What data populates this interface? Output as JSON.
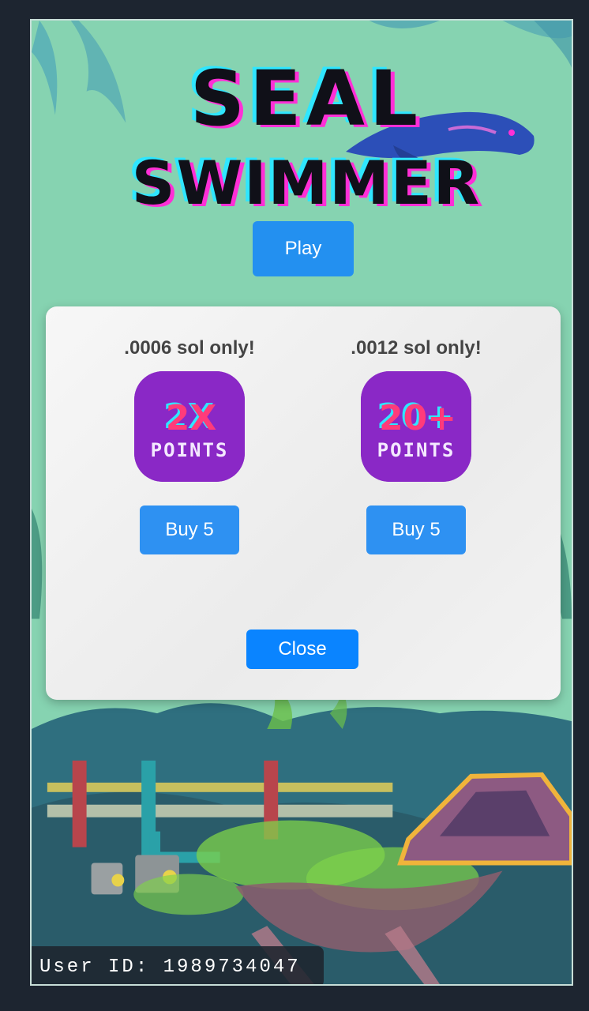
{
  "game": {
    "title_line1": "SEAL",
    "title_line2": "SWIMMER",
    "play_label": "Play"
  },
  "shop": {
    "offers": [
      {
        "price": ".0006 sol only!",
        "badge_top": "2X",
        "badge_bottom": "POINTS",
        "buy_label": "Buy 5"
      },
      {
        "price": ".0012 sol only!",
        "badge_top": "20+",
        "badge_bottom": "POINTS",
        "buy_label": "Buy 5"
      }
    ],
    "close_label": "Close"
  },
  "footer": {
    "user_id": "User ID: 1989734047"
  },
  "colors": {
    "background": "#86d3b1",
    "button_blue": "#2390f0",
    "close_blue": "#0a84ff",
    "badge_purple": "#8a28c6",
    "logo_magenta": "#ff2fd6",
    "logo_cyan": "#2fe6ff"
  }
}
